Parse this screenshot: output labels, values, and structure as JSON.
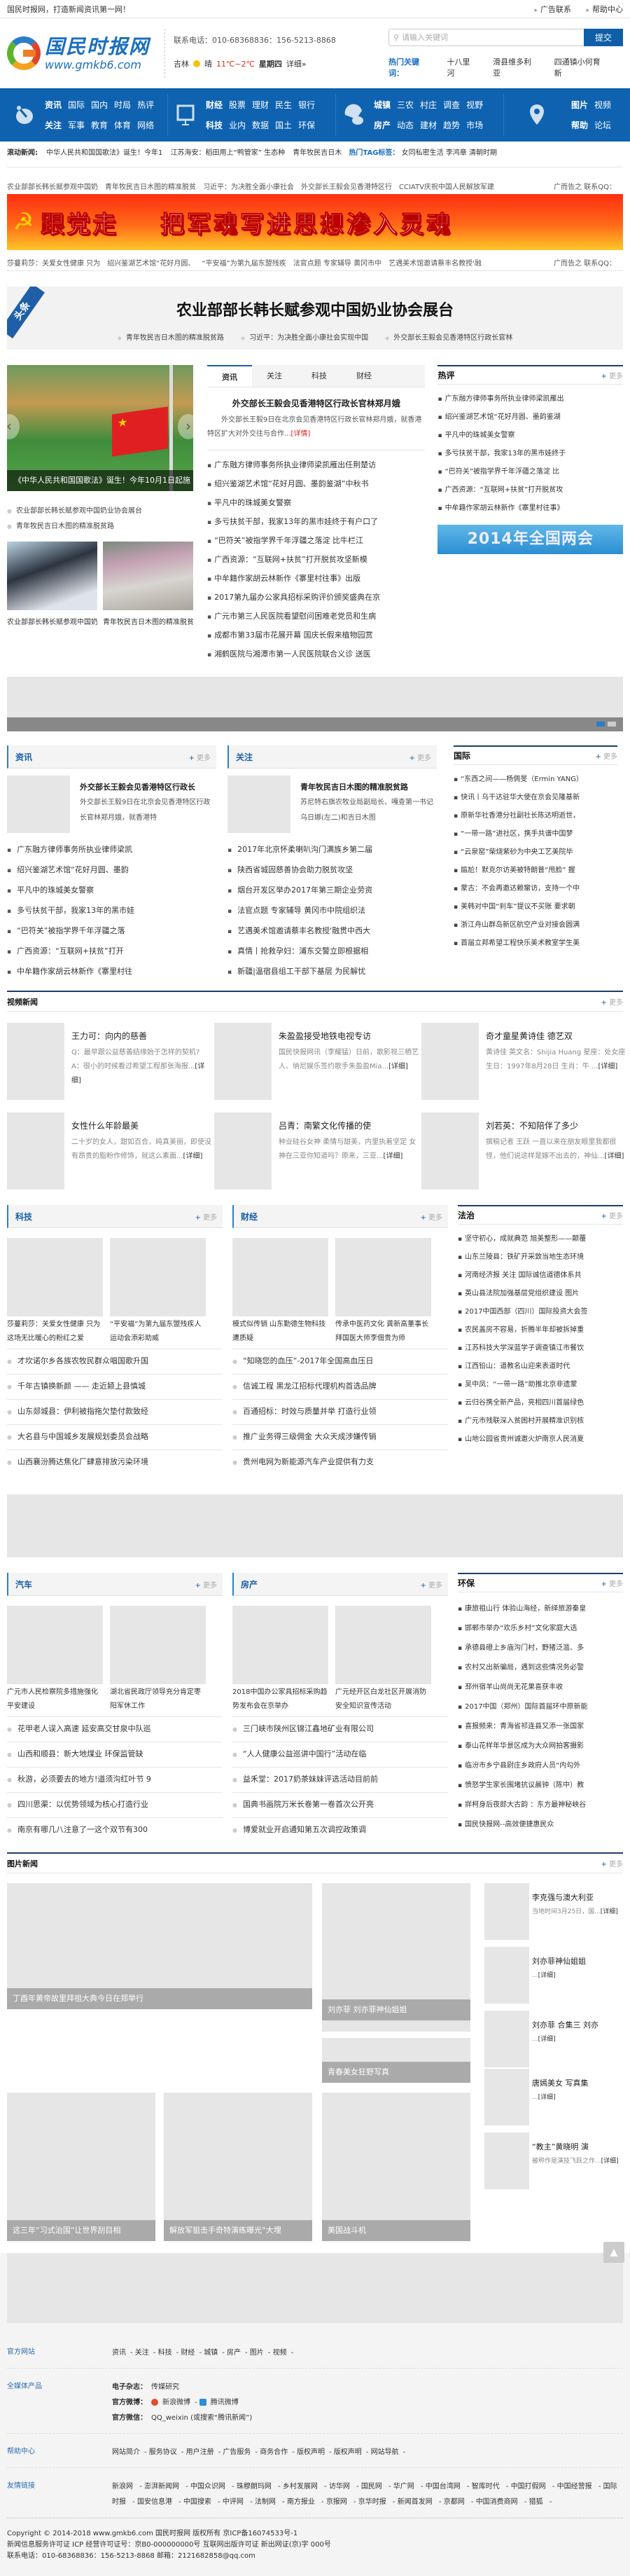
{
  "topbar": {
    "slogan": "国民时报网，打造新闻资讯第一网！",
    "links": [
      "广告联系",
      "帮助中心"
    ]
  },
  "header": {
    "logo_cn": "国民时报网",
    "logo_en": "www.gmkb6.com",
    "phone": "联系电话：010-68368836：156-5213-8868",
    "city": "吉林",
    "weather": "晴",
    "temp": "11℃~2℃",
    "weekday": "星期四",
    "detail": "详细»",
    "search_placeholder": "请输入关键词",
    "search_button": "提交",
    "hot_label": "热门关键词：",
    "hot_keywords": [
      "十八里河",
      "滑县维多利亚",
      "四通镇小何育新"
    ]
  },
  "nav": {
    "groups": [
      {
        "icon": "pen-icon",
        "rows": [
          [
            "资讯",
            "国际",
            "国内",
            "时局",
            "热评"
          ],
          [
            "关注",
            "军事",
            "教育",
            "体育",
            "网络"
          ]
        ]
      },
      {
        "icon": "presentation-board-icon",
        "rows": [
          [
            "财经",
            "股票",
            "理财",
            "民生",
            "银行"
          ],
          [
            "科技",
            "业内",
            "数据",
            "国土",
            "环保"
          ]
        ]
      },
      {
        "icon": "chat-bubbles-icon",
        "rows": [
          [
            "城镇",
            "三农",
            "村庄",
            "调查",
            "视野"
          ],
          [
            "房产",
            "动态",
            "建材",
            "趋势",
            "市场"
          ]
        ]
      },
      {
        "icon": "location-pin-icon",
        "rows": [
          [
            "图片",
            "视频"
          ],
          [
            "帮助",
            "论坛"
          ]
        ]
      }
    ]
  },
  "ticker": {
    "label": "滚动新闻:",
    "items": [
      "中华人民共和国国歌法》诞生！今年1",
      "江苏海安：稻田用上“鸭管家” 生态种",
      "青年牧民吉日木"
    ],
    "tag_label": "热门TAG标签：",
    "tags": [
      "女同私密生活",
      "李鸿章",
      "清朝时期"
    ]
  },
  "textlinks1": {
    "items": [
      "农业部部长韩长赋参观中国奶",
      "青年牧民吉日木图的精准脱贫",
      "习近平：为决胜全面小康社会",
      "外交部长王毅会见香港特区行",
      "CCIATV庆祝中国人民解放军建"
    ],
    "ad": "广而告之 联系QQ："
  },
  "banner": {
    "text1": "跟党走",
    "text2": "把军魂写进思想渗入灵魂"
  },
  "textlinks2": {
    "items": [
      "莎蔓莉莎：关爱女性健康 只为",
      "绍兴鉴湖艺术馆“花好月圆、",
      "“平安福”为第九届东盟残疾",
      "法官点题 专家辅导 黄冈市中",
      "艺遇美术馆邀请蔡丰名教授'融"
    ],
    "ad": "广而告之 联系QQ："
  },
  "headline": {
    "tag": "头条",
    "title": "农业部部长韩长赋参观中国奶业协会展台",
    "subs": [
      "青年牧民吉日木图的精准脱贫路",
      "习近平：为决胜全面小康社会实现中国",
      "外交部长王毅会见香港特区行政长官林"
    ]
  },
  "slider": {
    "caption": "《中华人民共和国国歌法》诞生！今年10月1日起施",
    "list": [
      "农业部部长韩长赋参观中国奶业协会展台",
      "青年牧民吉日木图的精准脱贫路"
    ],
    "thumbs": [
      "农业部部长韩长赋参观中国奶",
      "青年牧民吉日木图的精准脱贫"
    ]
  },
  "tabbox": {
    "tabs": [
      "资讯",
      "关注",
      "科技",
      "财经"
    ],
    "head": "外交部长王毅会见香港特区行政长官林郑月娥",
    "desc": "外交部长王毅9日在北京会见香港特区行政长官林郑月娥，就香港特区扩大对外交往与合作...",
    "desc_more": "[详情]",
    "list": [
      "广东融方律师事务所执业律师梁凯雁出任荆楚访",
      "绍兴鉴湖艺术馆“花好月圆、墨韵鉴湖”中秋书",
      "平凡中的珠城美女警察",
      "多亏扶贫干部，我家13年的黑市娃终于有户口了",
      "“巴符关”被指学界千年浮疆之落淀 比牛栏江",
      "广西资源：“互联网+扶贫”打开脱贫攻坚新模",
      "中牟籍作家胡云林新作《寨里村往事》出版",
      "2017第九届办公家具招标采购评价颁奖盛典在京",
      "广元市第三人民医院看望慰问困难老党员和生病",
      "成都市第33届市花展开幕 国庆长假来植物园赏",
      "湘鹤医院与湘潭市第一人民医院联合义诊 送医"
    ]
  },
  "hot": {
    "title": "热评",
    "more": "更多",
    "list": [
      "广东融方律师事务所执业律师梁凯雁出",
      "绍兴鉴湖艺术馆“花好月圆、墨韵鉴湖",
      "平凡中的珠城美女警察",
      "多亏扶贫干部，我家13年的黑市娃终于",
      "“巴符关”被指学界千年浮疆之落淀 比",
      "广西资源：“互联网+扶贫”打开脱贫攻",
      "中牟籍作家胡云林新作《寨里村往事》"
    ],
    "banner": "2014年全国两会"
  },
  "mod_news": {
    "title": "资讯",
    "more": "更多",
    "feat_title": "外交部长王毅会见香港特区行政长",
    "feat_desc": "外交部长王毅9日在北京会见香港特区行政长官林郑月娥，就香港特",
    "list": [
      "广东融方律师事务所执业律师梁凯",
      "绍兴鉴湖艺术馆“花好月圆、墨韵",
      "平凡中的珠城美女警察",
      "多亏扶贫干部，我家13年的黑市娃",
      "“巴符关”被指学界千年浮疆之落",
      "广西资源：“互联网+扶贫”打开",
      "中牟籍作家胡云林新作《寨里村往"
    ]
  },
  "mod_focus": {
    "title": "关注",
    "more": "更多",
    "feat_title": "青年牧民吉日木图的精准脱贫路",
    "feat_desc": "苏尼特右旗农牧业局副局长、嘎查第一书记乌日娜(左二)和吉日木图",
    "list": [
      "2017年北京怀柔喇叭沟门满族乡第二届",
      "陕西省城固慈善协会助力脱贫攻坚",
      "烟台开发区举办2017年第三期企业劳资",
      "法官点题 专家辅导 黄冈市中院组织法",
      "艺遇美术馆邀请蔡丰名教授'融贯中西大",
      "真情丨抢救孕妇：浦东交警立即根据相",
      "新疆|温宿县组工干部下基层 为民解忧"
    ]
  },
  "intl": {
    "title": "国际",
    "more": "更多",
    "list": [
      "“东西之间——杨倜旻（Ermin YANG）",
      "快讯丨乌干达驻华大使在京会见隆基新",
      "原新华社香港分社副社长陈达明逝世，",
      "“一带一路”进社区，携手共谱中国梦",
      "“云泉窑”柴烧紫砂为中央工艺美院毕",
      "尴尬！默克尔访美被特朗普“甩脸” 握",
      "蒙古：不会再邀达赖窜访，支持一个中",
      "美韩对中国“刹车”提议不买账 要求朝",
      "浙江舟山群岛新区航空产业对接会圆满",
      "首届立邦希望工程快乐美术教室学生美"
    ]
  },
  "video": {
    "title": "视频新闻",
    "more": "更多",
    "items": [
      {
        "title": "王力可：向内的慈善",
        "desc": "Q：最早跟公益慈善结缘始于怎样的契机? A：很小的时候看过希望工程那张海报...",
        "more": "[详细]"
      },
      {
        "title": "朱盈盈接受地铁电视专访",
        "desc": "国民快报网讯（李耀猛）日前，歌影视三栖艺人、纳尼娱乐签约歌手朱盈盈Mia...",
        "more": "[详细]"
      },
      {
        "title": "奇才童星黄诗佳 德艺双",
        "desc": "黄诗佳 英文名：Shijia Huang 星座：处女座 生日：1997年8月28日 生肖：牛 ...",
        "more": "[详细]"
      },
      {
        "title": "女性什么年龄最美",
        "desc": "二十岁的女人，甜如百合，纯真美丽，即使没有昂贵的脂粉作修饰，就这么素面...",
        "more": "[详细]"
      },
      {
        "title": "吕青：南繁文化传播的使",
        "desc": "种业硅谷女神 柔情与甜美，内里执着坚定 女神在三亚你知道吗？原来，三亚...",
        "more": "[详细]"
      },
      {
        "title": "刘若英：不知陪伴了多少",
        "desc": "撰稿记者 王跃 一直以来在朋友眼里我都很怪，他们说这样是嫁不出去的，神仙...",
        "more": "[详细]"
      }
    ]
  },
  "tech": {
    "title": "科技",
    "more": "更多",
    "thumbs": [
      "莎蔓莉莎：关爱女性健康 只为这场无比暖心的粉红之爱",
      "“平安福”为第九届东盟残疾人运动会添彩助威"
    ],
    "list": [
      "才坎诺尔乡各族农牧民群众唱国歌升国",
      "千年古镇换新颜 —— 走近颍上县慎城",
      "山东郯城县：伊利被指拖欠垫付款致经",
      "大名县与中国城乡发展规划委员会战略",
      "山西襄汾腾达焦化厂肆意排放污染环境"
    ]
  },
  "finance": {
    "title": "财经",
    "more": "更多",
    "thumbs": [
      "模式似传销 山东勤德生物科技遭质疑",
      "传承中医药文化 龚新高董事长拜国医大师李佃贵为师"
    ],
    "list": [
      "“知晓您的血压”-2017年全国高血压日",
      "信诚工程 黑龙江招标代理机构首选品牌",
      "百通招标：时效与质量并举 打造行业领",
      "推广业务得三级佣金 大众天成涉嫌传销",
      "贵州电网为新能源汽车产业提供有力支"
    ]
  },
  "law": {
    "title": "法治",
    "more": "更多",
    "list": [
      "坚守初心，成就典范 旭美整形——颠覆",
      "山东兰陵县：铁矿开采致当地生态环境",
      "河南经济报 关注 国际诚信道德体系共",
      "英山县法院加强基层党组织建设 图片",
      "2017中国西部（四川）国际投资大会签",
      "农民盖房不容易，折腾半年却被拆掉重",
      "江苏科技大学深蓝学子调查镇江市餐饮",
      "江西铅山：道教名山迎来表道时代",
      "吴中凤：“一带一路”助推北京非遗蒙",
      "云归谷携全新产品，亮相四川首届绿色",
      "广元市残联深入贫困村开展精准识别核",
      "山地公园省贵州诚邀火炉南京人民消夏"
    ]
  },
  "auto": {
    "title": "汽车",
    "more": "更多",
    "thumbs": [
      "广元市人民检察院多措施强化平安建设",
      "湖北省民政厅领导充分肯定枣阳军休工作"
    ],
    "list": [
      "花甲老人误入高速 延安高交甘泉中队巡",
      "山西和顺县：新大地煤业 环保监管缺",
      "秋游，必须要去的地方!道须沟红叶节 9",
      "四川思渠：以优势领域为核心打造行业",
      "南京有哪几八注意了一这个双节有300"
    ]
  },
  "estate": {
    "title": "房产",
    "more": "更多",
    "thumbs": [
      "2018中国办公家具招标采购趋势发布会在京举办",
      "广元经开区白龙社区开展消防安全知识宣传活动"
    ],
    "list": [
      "三门峡市陕州区锦江鑫地矿业有限公司",
      "“人人健康公益巡讲中国行”活动在临",
      "益禾堂：2017奶茶妹妹评选活动目前前",
      "国典书画院万米长卷第一卷首次公开亮",
      "博爱就业开启通知第五次调控政策调"
    ]
  },
  "env": {
    "title": "环保",
    "more": "更多",
    "list": [
      "康旅祖山行 体验山海经，新绎旅游秦皇",
      "邯郸市举办“欢乐乡村”文化家庭大选",
      "承德县磴上乡庙沟门村，野猪泛滥、多",
      "农村又出新骗局，遇到这些情况务必警",
      "邳州宿羊山尚尚无花果喜获丰收",
      "2017中国（郑州）国际首届环中原新能",
      "喜报频来：青海省祁连县又添一张国家",
      "泰山花样年华景区成为大众网拍客摄影",
      "临汾市乡宁县尉庄乡政府人员“内勾外",
      "愤怒学生家长围堵抗议晨钟（陈中）教",
      "牂柯身后夜郎大古韵 ：东方最神秘峡谷",
      "国民快报网--高效便捷惠民众"
    ]
  },
  "pics": {
    "title": "图片新闻",
    "more": "更多",
    "big": "丁酉年黄帝故里拜祖大典今日在郑举行",
    "mid1": "刘亦菲 刘亦菲神仙姐姐",
    "mid2": "青春美女狂野写真",
    "small1": "这三年“习式治国”让世界刮目相",
    "small2": "解放军狙击手奇特演练曝光“大埋",
    "small3": "美国战斗机",
    "list": [
      {
        "title": "李克强与澳大利亚",
        "desc": "当地时间3月25日，国...",
        "more": "[详细]"
      },
      {
        "title": "刘亦菲神仙姐姐",
        "desc": "...",
        "more": "[详细]"
      },
      {
        "title": "刘亦菲 合集三 刘亦",
        "desc": "...",
        "more": "[详细]"
      },
      {
        "title": "唐嫣美女 写真集",
        "desc": "...",
        "more": "[详细]"
      },
      {
        "title": "“教主”黄晓明 演",
        "desc": "被称作是演技飞跃之作...",
        "more": "[详细]"
      }
    ]
  },
  "footer": {
    "official_label": "官方网站",
    "official_links": [
      "资讯",
      "关注",
      "科技",
      "财经",
      "城镇",
      "房产",
      "图片",
      "视频"
    ],
    "media_label": "全媒体产品",
    "magazine_label": "电子杂志：",
    "magazine": "传媒研究",
    "weibo_label": "官方微博：",
    "weibo1": "新浪微博",
    "weibo2": "腾讯微博",
    "wechat_label": "官方微信：",
    "wechat": "QQ_weixin (或搜索“腾讯新闻”)",
    "help_label": "帮助中心",
    "help_links": [
      "网站简介",
      "服务协议",
      "用户注册",
      "广告服务",
      "商务合作",
      "版权声明",
      "版权声明",
      "网站导航"
    ],
    "friend_label": "友情链接",
    "friend_links": [
      "新浪网",
      "澎湃新闻网",
      "中国众识网",
      "珠穆朗玛网",
      "乡村发展网",
      "访华网",
      "国民网",
      "华广网",
      "中国台湾网",
      "智库时代",
      "中国打假网",
      "中国经营报",
      "国际时报",
      "国安信息港",
      "中国搜索",
      "中评网",
      "法制网",
      "南方报业",
      "京报网",
      "京华时报",
      "新闻首发网",
      "京都网",
      "中国消费商网",
      "猎狐"
    ],
    "copyright": "Copyright © 2014-2018 www.gmkb6.com 国民时报网 版权所有 京ICP备16074533号-1",
    "license": "新闻信息服务许可证 ICP 经营许可证号：京B0-000000000号 互联网出版许可证 新出网证(京)字 000号",
    "contact": "联系电话：010-68368836：156-5213-8868 邮箱：2121682858@qq.com"
  }
}
